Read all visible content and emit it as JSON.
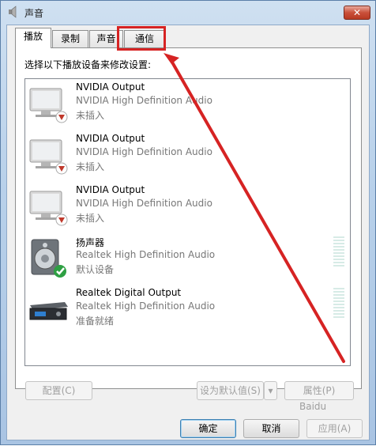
{
  "window": {
    "title": "声音",
    "close_label": "✕"
  },
  "tabs": [
    {
      "label": "播放"
    },
    {
      "label": "录制"
    },
    {
      "label": "声音"
    },
    {
      "label": "通信"
    }
  ],
  "instruction": "选择以下播放设备来修改设置:",
  "devices": [
    {
      "name": "NVIDIA Output",
      "description": "NVIDIA High Definition Audio",
      "status": "未插入",
      "icon": "monitor-icon"
    },
    {
      "name": "NVIDIA Output",
      "description": "NVIDIA High Definition Audio",
      "status": "未插入",
      "icon": "monitor-icon"
    },
    {
      "name": "NVIDIA Output",
      "description": "NVIDIA High Definition Audio",
      "status": "未插入",
      "icon": "monitor-icon"
    },
    {
      "name": "扬声器",
      "description": "Realtek High Definition Audio",
      "status": "默认设备",
      "icon": "speaker-icon"
    },
    {
      "name": "Realtek Digital Output",
      "description": "Realtek High Definition Audio",
      "status": "准备就绪",
      "icon": "digital-output-icon"
    }
  ],
  "buttons": {
    "configure": "配置(C)",
    "set_default": "设为默认值(S)",
    "properties": "属性(P)",
    "ok": "确定",
    "cancel": "取消",
    "apply": "应用(A)"
  },
  "colors": {
    "highlight": "#d62323"
  }
}
